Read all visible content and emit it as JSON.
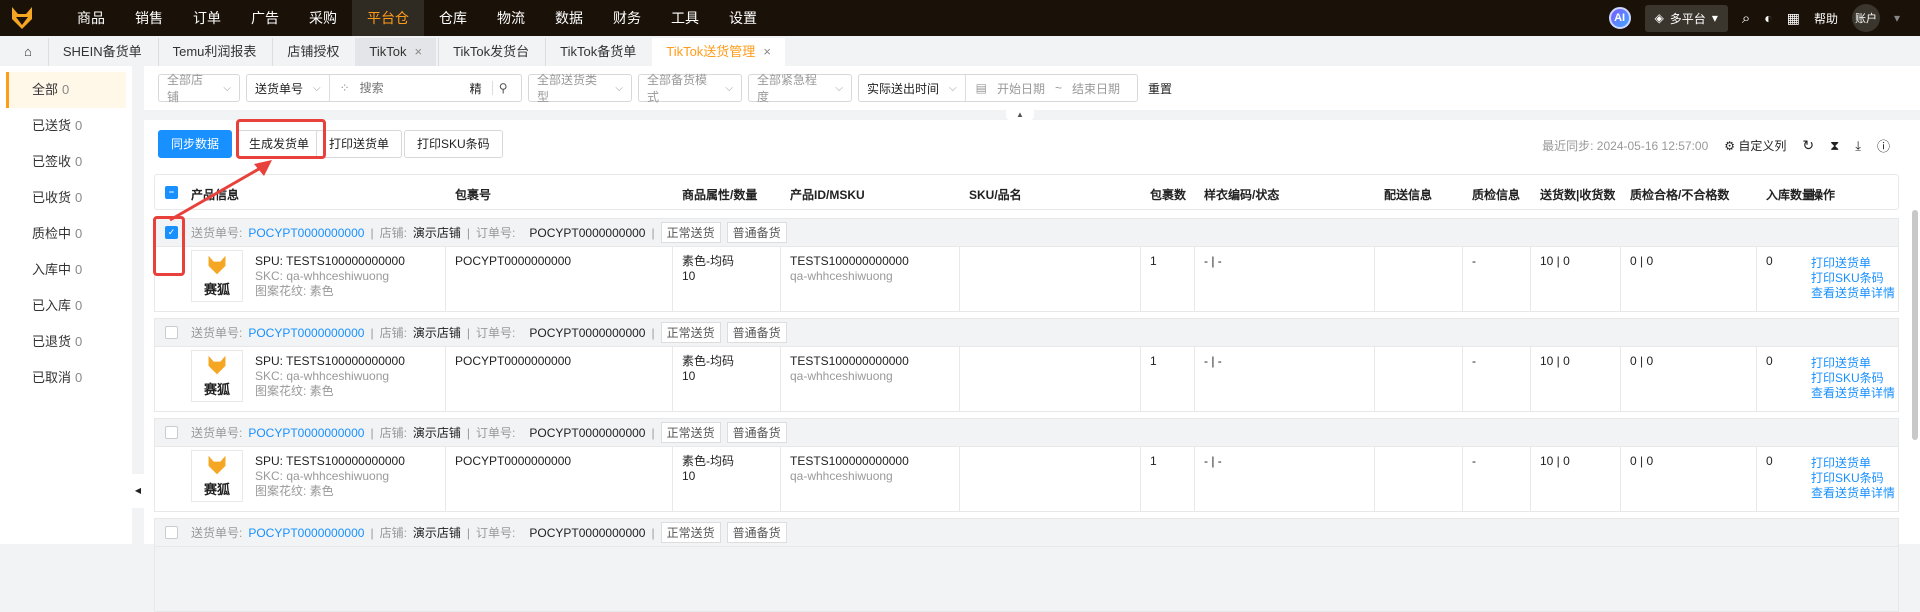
{
  "nav": {
    "items": [
      "商品",
      "销售",
      "订单",
      "广告",
      "采购",
      "平台仓",
      "仓库",
      "物流",
      "数据",
      "财务",
      "工具",
      "设置"
    ],
    "active": "平台仓",
    "ai": "AI",
    "platform": "多平台",
    "help": "帮助",
    "account": "账户"
  },
  "tabs": [
    {
      "label": "SHEIN备货单"
    },
    {
      "label": "Temu利润报表"
    },
    {
      "label": "店铺授权"
    },
    {
      "label": "TikTok",
      "closable": true
    },
    {
      "label": "TikTok发货台"
    },
    {
      "label": "TikTok备货单"
    },
    {
      "label": "TikTok送货管理",
      "closable": true,
      "active": true
    }
  ],
  "sidebar": [
    {
      "label": "全部",
      "count": "0"
    },
    {
      "label": "已送货",
      "count": "0"
    },
    {
      "label": "已签收",
      "count": "0"
    },
    {
      "label": "已收货",
      "count": "0"
    },
    {
      "label": "质检中",
      "count": "0"
    },
    {
      "label": "入库中",
      "count": "0"
    },
    {
      "label": "已入库",
      "count": "0"
    },
    {
      "label": "已退货",
      "count": "0"
    },
    {
      "label": "已取消",
      "count": "0"
    }
  ],
  "filters": {
    "store": "全部店铺",
    "search_type": "送货单号",
    "search_placeholder": "搜索",
    "exact": "精",
    "ship_type": "全部送货类型",
    "stock_mode": "全部备货模式",
    "urgency": "全部紧急程度",
    "time_type": "实际送出时间",
    "start_placeholder": "开始日期",
    "tilde": "~",
    "end_placeholder": "结束日期",
    "reset": "重置"
  },
  "toolbar": {
    "sync": "同步数据",
    "generate": "生成发货单",
    "print_delivery": "打印送货单",
    "print_sku": "打印SKU条码",
    "last_sync": "最近同步: 2024-05-16 12:57:00",
    "custom_cols": "自定义列"
  },
  "columns": [
    "产品信息",
    "包裹号",
    "商品属性/数量",
    "产品ID/MSKU",
    "SKU/品名",
    "包裹数",
    "样衣编码/状态",
    "配送信息",
    "质检信息",
    "送货数|收货数",
    "质检合格/不合格数",
    "入库数量",
    "操作"
  ],
  "rows": [
    {
      "checked": true,
      "delivery_label": "送货单号:",
      "delivery_no": "POCYPT0000000000",
      "store_label": "店铺:",
      "store": "演示店铺",
      "order_label": "订单号:",
      "order_no": "POCYPT0000000000",
      "tags": [
        "正常送货",
        "普通备货"
      ],
      "thumb": "赛狐",
      "spu": "SPU: TESTS100000000000",
      "skc": "SKC: qa-whhceshiwuong",
      "pattern": "图案花纹: 素色",
      "package_no": "POCYPT0000000000",
      "attr": "素色-均码",
      "qty": "10",
      "product_id": "TESTS100000000000",
      "msku": "qa-whhceshiwuong",
      "packages": "1",
      "sample": "- | -",
      "qc": "-",
      "sent_recv": "10 | 0",
      "qc_pass_fail": "0 | 0",
      "stocked": "0",
      "ops": [
        "打印送货单",
        "打印SKU条码",
        "查看送货单详情"
      ]
    },
    {
      "checked": false,
      "delivery_label": "送货单号:",
      "delivery_no": "POCYPT0000000000",
      "store_label": "店铺:",
      "store": "演示店铺",
      "order_label": "订单号:",
      "order_no": "POCYPT0000000000",
      "tags": [
        "正常送货",
        "普通备货"
      ],
      "thumb": "赛狐",
      "spu": "SPU: TESTS100000000000",
      "skc": "SKC: qa-whhceshiwuong",
      "pattern": "图案花纹: 素色",
      "package_no": "POCYPT0000000000",
      "attr": "素色-均码",
      "qty": "10",
      "product_id": "TESTS100000000000",
      "msku": "qa-whhceshiwuong",
      "packages": "1",
      "sample": "- | -",
      "qc": "-",
      "sent_recv": "10 | 0",
      "qc_pass_fail": "0 | 0",
      "stocked": "0",
      "ops": [
        "打印送货单",
        "打印SKU条码",
        "查看送货单详情"
      ]
    },
    {
      "checked": false,
      "delivery_label": "送货单号:",
      "delivery_no": "POCYPT0000000000",
      "store_label": "店铺:",
      "store": "演示店铺",
      "order_label": "订单号:",
      "order_no": "POCYPT0000000000",
      "tags": [
        "正常送货",
        "普通备货"
      ],
      "thumb": "赛狐",
      "spu": "SPU: TESTS100000000000",
      "skc": "SKC: qa-whhceshiwuong",
      "pattern": "图案花纹: 素色",
      "package_no": "POCYPT0000000000",
      "attr": "素色-均码",
      "qty": "10",
      "product_id": "TESTS100000000000",
      "msku": "qa-whhceshiwuong",
      "packages": "1",
      "sample": "- | -",
      "qc": "-",
      "sent_recv": "10 | 0",
      "qc_pass_fail": "0 | 0",
      "stocked": "0",
      "ops": [
        "打印送货单",
        "打印SKU条码",
        "查看送货单详情"
      ]
    },
    {
      "checked": false,
      "delivery_label": "送货单号:",
      "delivery_no": "POCYPT0000000000",
      "store_label": "店铺:",
      "store": "演示店铺",
      "order_label": "订单号:",
      "order_no": "POCYPT0000000000",
      "tags": [
        "正常送货",
        "普通备货"
      ]
    }
  ],
  "colors": {
    "accent": "#ff9c1a",
    "primary": "#1890ff",
    "annotation": "#e8413b"
  }
}
